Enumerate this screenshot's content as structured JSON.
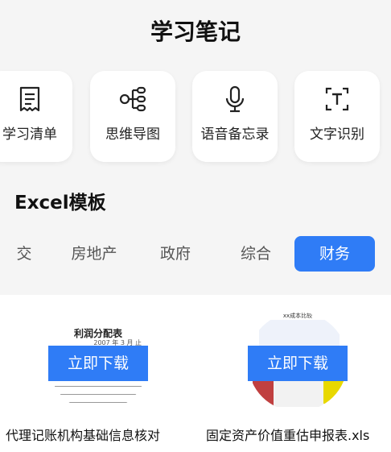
{
  "header": {
    "title": "学习笔记"
  },
  "tools": [
    {
      "label": "学习清单",
      "icon": "receipt-list-icon"
    },
    {
      "label": "思维导图",
      "icon": "mind-map-icon"
    },
    {
      "label": "语音备忘录",
      "icon": "microphone-icon"
    },
    {
      "label": "文字识别",
      "icon": "text-scan-icon"
    }
  ],
  "section": {
    "title": "Excel模板"
  },
  "tabs": [
    {
      "label": "交",
      "active": false
    },
    {
      "label": "房地产",
      "active": false
    },
    {
      "label": "政府",
      "active": false
    },
    {
      "label": "综合",
      "active": false
    },
    {
      "label": "财务",
      "active": true
    }
  ],
  "templates": [
    {
      "filename": "代理记账机构基础信息核对表.xls",
      "download_label": "立即下载",
      "preview_title": "利润分配表",
      "preview_text": "2007 年 3 月 止"
    },
    {
      "filename": "固定资产价值重估申报表.xls",
      "download_label": "立即下载",
      "preview_title": "xx成本比较"
    }
  ],
  "colors": {
    "accent": "#2f7cf6",
    "top_bg": "#f5f5f5"
  }
}
